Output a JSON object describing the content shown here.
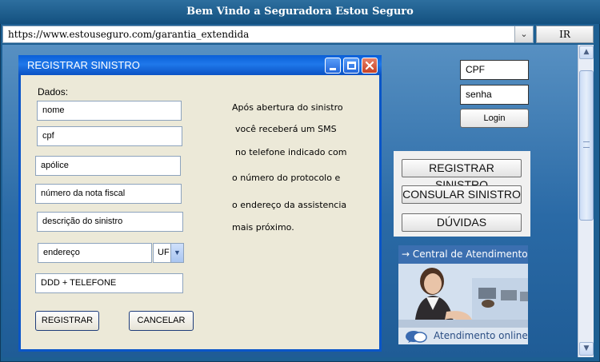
{
  "browser": {
    "title": "Bem Vindo a Seguradora Estou Seguro",
    "url": "https://www.estouseguro.com/garantia_extendida",
    "go_label": "IR"
  },
  "dialog": {
    "title": "REGISTRAR SINISTRO",
    "section_label": "Dados:",
    "fields": {
      "nome": "nome",
      "cpf": "cpf",
      "apolice": "apólice",
      "nota_fiscal": "número da nota fiscal",
      "descricao": "descrição do sinistro",
      "endereco": "endereço",
      "uf": "UF",
      "telefone": "DDD + TELEFONE"
    },
    "buttons": {
      "registrar": "REGISTRAR",
      "cancelar": "CANCELAR"
    },
    "info_lines": [
      "Após abertura do sinistro",
      "você receberá um SMS",
      "no telefone indicado com",
      "o número do protocolo e",
      "o endereço da assistencia",
      "mais próximo."
    ]
  },
  "login": {
    "cpf_placeholder": "CPF",
    "senha_placeholder": "senha",
    "button": "Login"
  },
  "menu": {
    "registrar": "REGISTRAR SINISTRO",
    "consultar": "CONSULAR SINISTRO",
    "duvidas": "DÚVIDAS"
  },
  "support": {
    "header": "Central de Atendimento",
    "header_arrow": "→",
    "online": "Atendimento online"
  }
}
